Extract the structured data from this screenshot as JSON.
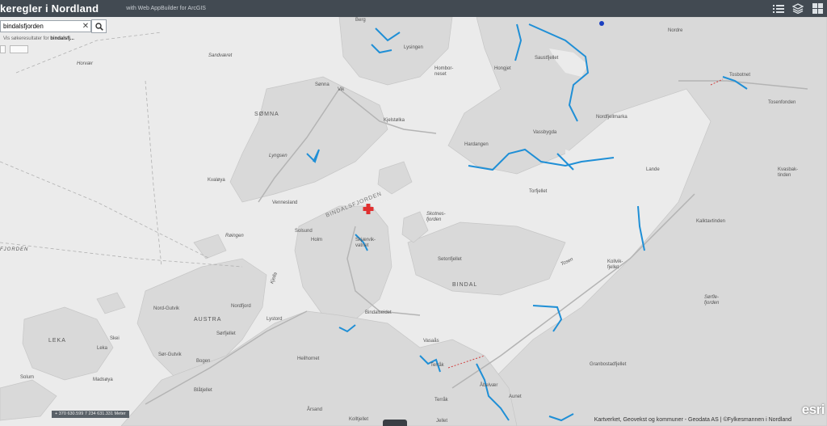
{
  "header": {
    "title": "keregler i Nordland",
    "subtitle": "with Web AppBuilder for ArcGIS",
    "background": "#424a52"
  },
  "search": {
    "value": "bindalsfjorden",
    "clear_symbol": "✕",
    "hint_prefix": "Vis søkeresultater for ",
    "hint_term": "bindalsfj..."
  },
  "coordinates": "+ 370 630.599 7 234 631.331 Meter",
  "attribution": "Kartverket, Geovekst og kommuner - Geodata AS | ©Fylkesmannen i Nordland",
  "esri_logo": "esri",
  "colors": {
    "water_line": "#1f8fd6",
    "marker": "#e03030",
    "road": "#b4b4b4"
  },
  "map_labels": {
    "berg": "Berg",
    "lysingen": "Lysingen",
    "horvaer": "Horvær",
    "sandvaeret": "Sandværet",
    "sonna": "Sønna",
    "vik": "Vik",
    "somna": "SØMNA",
    "hombornes": "Hombor-\nneset",
    "horvgjet": "Hongjet",
    "saustfjellet": "Saustfjellet",
    "nordre": "Nordre",
    "tosbotnet": "Tosbotnet",
    "tosenfonden": "Tosenfonden",
    "nordfjellmarka": "Nordfjellmarka",
    "vassbygda": "Vassbygda",
    "hardangen": "Hardangen",
    "kjelstolka": "Kjelstølka",
    "lyngsen": "Lyngsen",
    "kvaloya": "Kvaløya",
    "vennesland": "Vennesland",
    "bindalsfjorden": "BINDALSFJORDEN",
    "torfjellet": "Torfjellet",
    "lande": "Lande",
    "kvasbak": "Kvasbak-\ntinden",
    "solsund": "Solsund",
    "holm": "Holm",
    "skjaervika": "Skjærvik-\nvatnet",
    "skotnes": "Skotnes-\nfjorden",
    "ringen": "Røingen",
    "fjorden": "FJORDEN",
    "setonfjellet": "Setonfjellet",
    "bindal": "BINDAL",
    "tosen": "Tosen",
    "kalktavinden": "Kalktavtinden",
    "kollvik": "Kollvik-\nfjellet",
    "nordgutvik": "Nord-Gutvik",
    "austra": "AUSTRA",
    "nordfjord": "Nordfjord",
    "kjella": "Kjella",
    "lystord": "Lystord",
    "bindalseidet": "Bindalseidet",
    "leka": "LEKA",
    "skei": "Skei",
    "leka2": "Leka",
    "sorgutvik": "Sør-Gutvik",
    "sorfjellet": "Sørfjellet",
    "bogen": "Bogen",
    "heilhornet": "Heilhornet",
    "vasaas": "Vasaås",
    "terraak": "Terråk",
    "granbostadfjellet": "Granbostadfjellet",
    "solum": "Solum",
    "madsaya": "Madsøya",
    "abelvaer": "Åbelvær",
    "aunet": "Aunet",
    "terrak2": "Terråk",
    "blatjellet": "Blåtjellet",
    "arsand": "Årsand",
    "kolltjellet": "Kolltjellet",
    "ellet": "Jellet",
    "sorle": "Sørfle-\nfjorden"
  }
}
